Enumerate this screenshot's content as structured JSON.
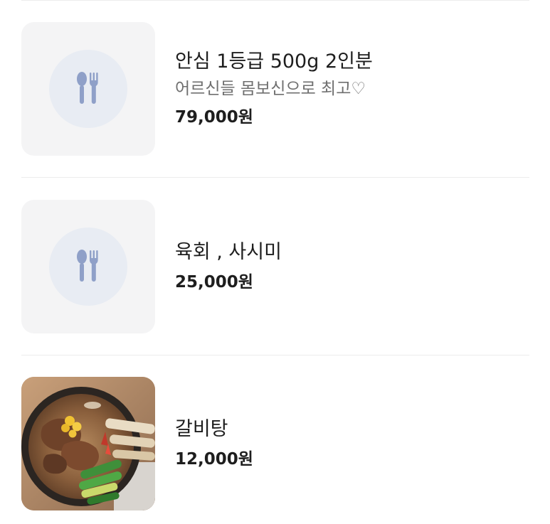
{
  "menu_items": [
    {
      "name": "안심 1등급 500g 2인분",
      "description": "어르신들 몸보신으로 최고♡",
      "price": "79,000원",
      "image": "placeholder-utensils-icon"
    },
    {
      "name": "육회 , 사시미",
      "description": "",
      "price": "25,000원",
      "image": "placeholder-utensils-icon"
    },
    {
      "name": "갈비탕",
      "description": "",
      "price": "12,000원",
      "image": "galbitang-photo"
    }
  ],
  "colors": {
    "thumb_bg": "#f4f4f5",
    "placeholder_circle": "#e8ecf3",
    "utensil_icon": "#8fa0c8",
    "divider": "#ececec",
    "text": "#1e1e1e",
    "muted_text": "#6f6f6f"
  }
}
